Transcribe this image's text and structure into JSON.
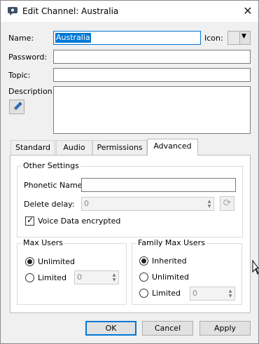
{
  "window": {
    "title": "Edit Channel: Australia",
    "close_glyph": "✕"
  },
  "form": {
    "name_label": "Name:",
    "name_value": "Australia",
    "icon_label": "Icon:",
    "password_label": "Password:",
    "password_value": "",
    "topic_label": "Topic:",
    "topic_value": "",
    "description_label": "Description:",
    "description_value": ""
  },
  "tabs": [
    {
      "label": "Standard",
      "active": false
    },
    {
      "label": "Audio",
      "active": false
    },
    {
      "label": "Permissions",
      "active": false
    },
    {
      "label": "Advanced",
      "active": true
    }
  ],
  "advanced": {
    "other_settings_title": "Other Settings",
    "phonetic_name_label": "Phonetic Name:",
    "phonetic_name_value": "",
    "delete_delay_label": "Delete delay:",
    "delete_delay_value": "0",
    "voice_encrypted_label": "Voice Data encrypted",
    "voice_encrypted_checked": true,
    "max_users": {
      "title": "Max Users",
      "unlimited_label": "Unlimited",
      "limited_label": "Limited",
      "limited_value": "0",
      "selected": "Unlimited"
    },
    "family_max_users": {
      "title": "Family Max Users",
      "inherited_label": "Inherited",
      "unlimited_label": "Unlimited",
      "limited_label": "Limited",
      "limited_value": "0",
      "selected": "Inherited"
    }
  },
  "buttons": {
    "ok": "OK",
    "cancel": "Cancel",
    "apply": "Apply"
  },
  "colors": {
    "accent": "#0078d7",
    "window_bg": "#f0f0f0",
    "panel_bg": "#ffffff"
  },
  "icons": [
    "app-logo-icon",
    "close-icon",
    "chevron-down-icon",
    "pencil-icon",
    "refresh-icon",
    "checkmark-icon"
  ]
}
